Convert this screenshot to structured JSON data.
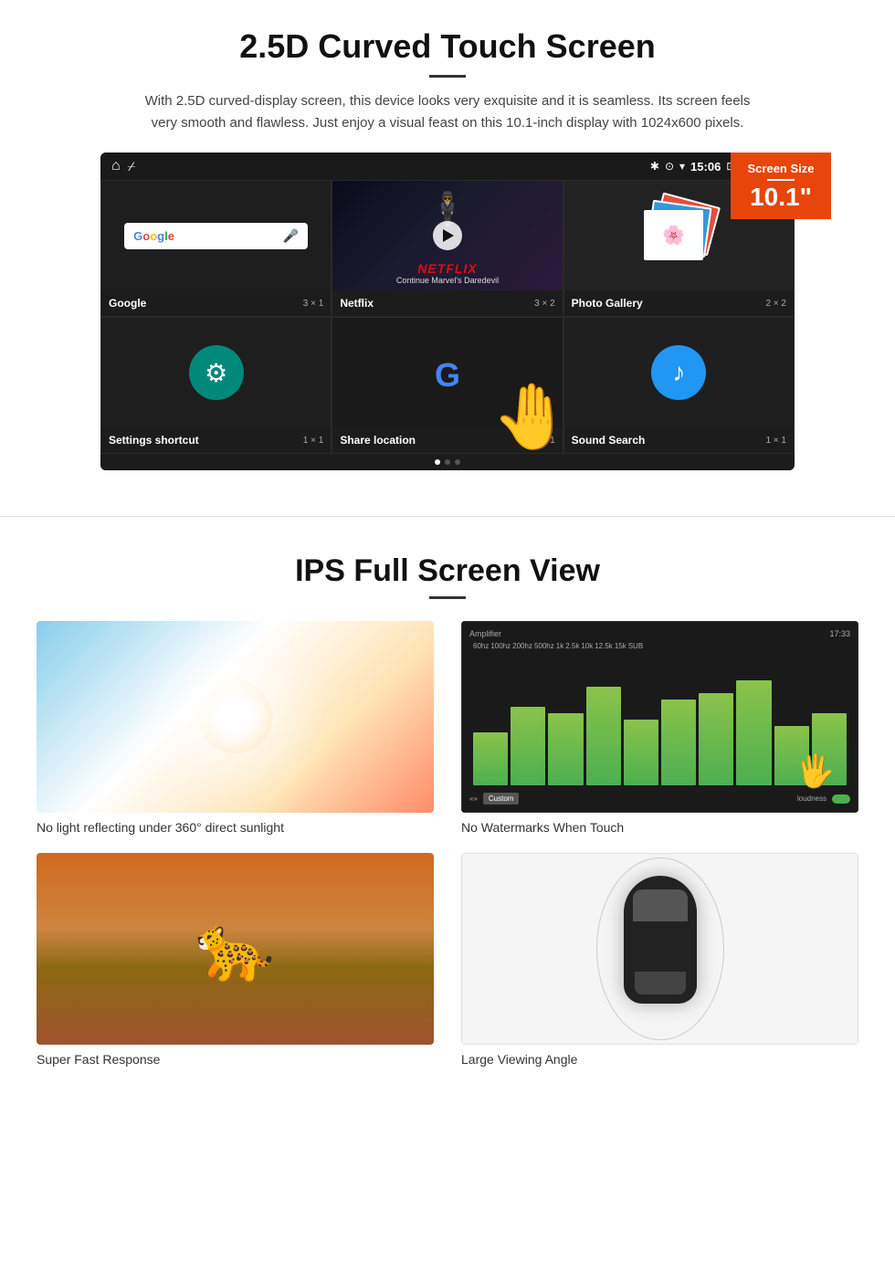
{
  "section1": {
    "title": "2.5D Curved Touch Screen",
    "description": "With 2.5D curved-display screen, this device looks very exquisite and it is seamless. Its screen feels very smooth and flawless. Just enjoy a visual feast on this 10.1-inch display with 1024x600 pixels.",
    "badge": {
      "label": "Screen Size",
      "value": "10.1\""
    },
    "statusBar": {
      "time": "15:06"
    },
    "apps": {
      "google": {
        "name": "Google",
        "size": "3 × 1"
      },
      "netflix": {
        "name": "Netflix",
        "size": "3 × 2",
        "logo": "NETFLIX",
        "subtitle": "Continue Marvel's Daredevil"
      },
      "photoGallery": {
        "name": "Photo Gallery",
        "size": "2 × 2"
      },
      "settings": {
        "name": "Settings shortcut",
        "size": "1 × 1"
      },
      "shareLocation": {
        "name": "Share location",
        "size": "1 × 1"
      },
      "soundSearch": {
        "name": "Sound Search",
        "size": "1 × 1"
      }
    }
  },
  "section2": {
    "title": "IPS Full Screen View",
    "features": [
      {
        "id": "sunlight",
        "caption": "No light reflecting under 360° direct sunlight"
      },
      {
        "id": "watermarks",
        "caption": "No Watermarks When Touch"
      },
      {
        "id": "cheetah",
        "caption": "Super Fast Response"
      },
      {
        "id": "car",
        "caption": "Large Viewing Angle"
      }
    ]
  }
}
